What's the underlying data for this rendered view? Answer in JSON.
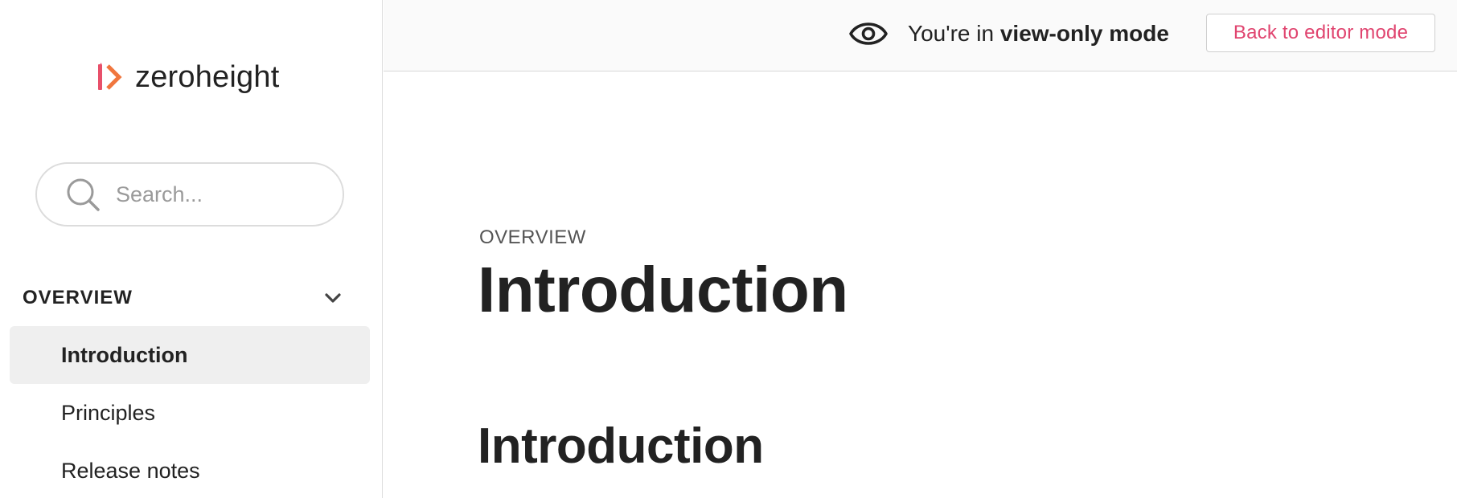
{
  "brand": {
    "name": "zeroheight",
    "accent_color": "#e0446f"
  },
  "search": {
    "placeholder": "Search..."
  },
  "sidebar": {
    "section_title": "OVERVIEW",
    "items": [
      {
        "label": "Introduction",
        "active": true
      },
      {
        "label": "Principles",
        "active": false
      },
      {
        "label": "Release notes",
        "active": false
      }
    ]
  },
  "topbar": {
    "mode_prefix": "You're in ",
    "mode_bold": "view-only mode",
    "back_button": "Back to editor mode"
  },
  "main": {
    "eyebrow": "OVERVIEW",
    "title": "Introduction",
    "section_heading": "Introduction"
  },
  "icons": {
    "logo": "zeroheight-logo-icon",
    "search": "search-icon",
    "chevron": "chevron-down-icon",
    "eye": "eye-icon"
  }
}
